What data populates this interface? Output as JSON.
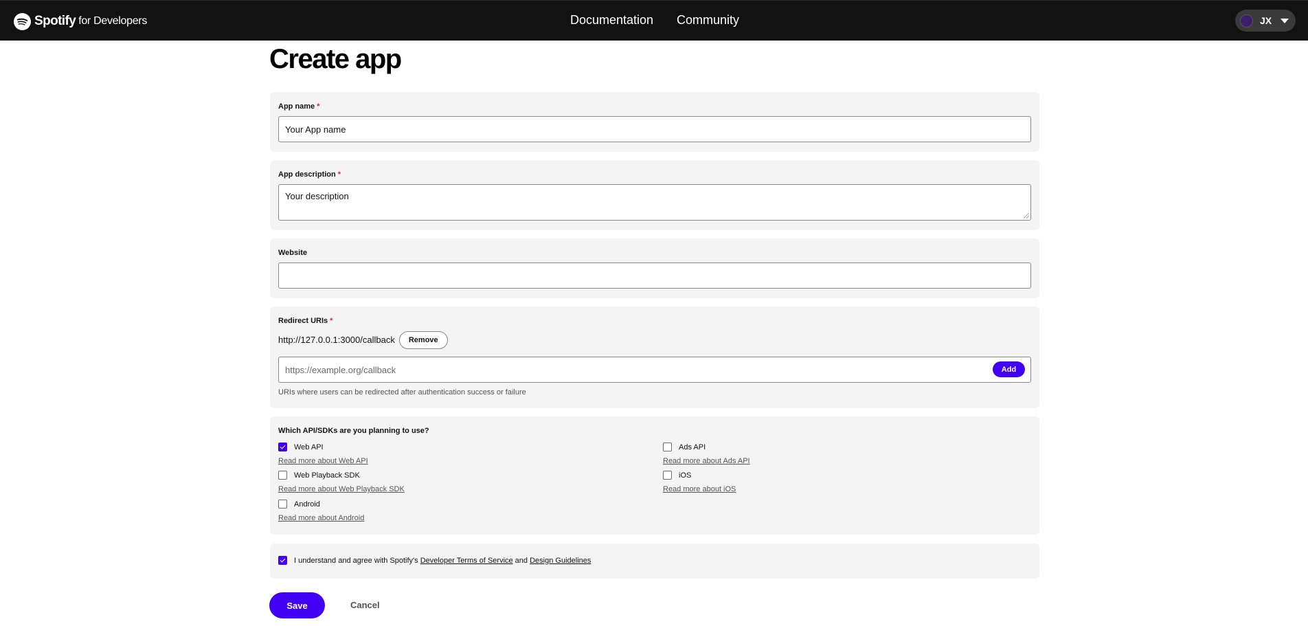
{
  "header": {
    "brand_name": "Spotify",
    "brand_suffix": "for Developers",
    "nav": [
      "Documentation",
      "Community"
    ],
    "user_initials": "JX"
  },
  "page": {
    "title": "Create app"
  },
  "form": {
    "app_name": {
      "label": "App name",
      "required": "*",
      "value": "Your App name"
    },
    "app_description": {
      "label": "App description",
      "required": "*",
      "value": "Your description"
    },
    "website": {
      "label": "Website",
      "value": ""
    },
    "redirect_uris": {
      "label": "Redirect URIs",
      "required": "*",
      "existing": "http://127.0.0.1:3000/callback",
      "remove_label": "Remove",
      "placeholder": "https://example.org/callback",
      "add_label": "Add",
      "hint": "URIs where users can be redirected after authentication success or failure"
    },
    "apis": {
      "question": "Which API/SDKs are you planning to use?",
      "items": [
        {
          "label": "Web API",
          "checked": true,
          "link": "Read more about Web API"
        },
        {
          "label": "Ads API",
          "checked": false,
          "link": "Read more about Ads API"
        },
        {
          "label": "Web Playback SDK",
          "checked": false,
          "link": "Read more about Web Playback SDK"
        },
        {
          "label": "iOS",
          "checked": false,
          "link": "Read more about iOS"
        },
        {
          "label": "Android",
          "checked": false,
          "link": "Read more about Android"
        }
      ]
    },
    "terms": {
      "checked": true,
      "prefix": "I understand and agree with Spotify's ",
      "tos_link": "Developer Terms of Service",
      "and": " and ",
      "guidelines_link": "Design Guidelines"
    }
  },
  "actions": {
    "save": "Save",
    "cancel": "Cancel"
  },
  "colors": {
    "accent": "#4100f4",
    "header_bg": "#121212",
    "required": "#e22134",
    "card_bg": "#f4f4f4"
  }
}
